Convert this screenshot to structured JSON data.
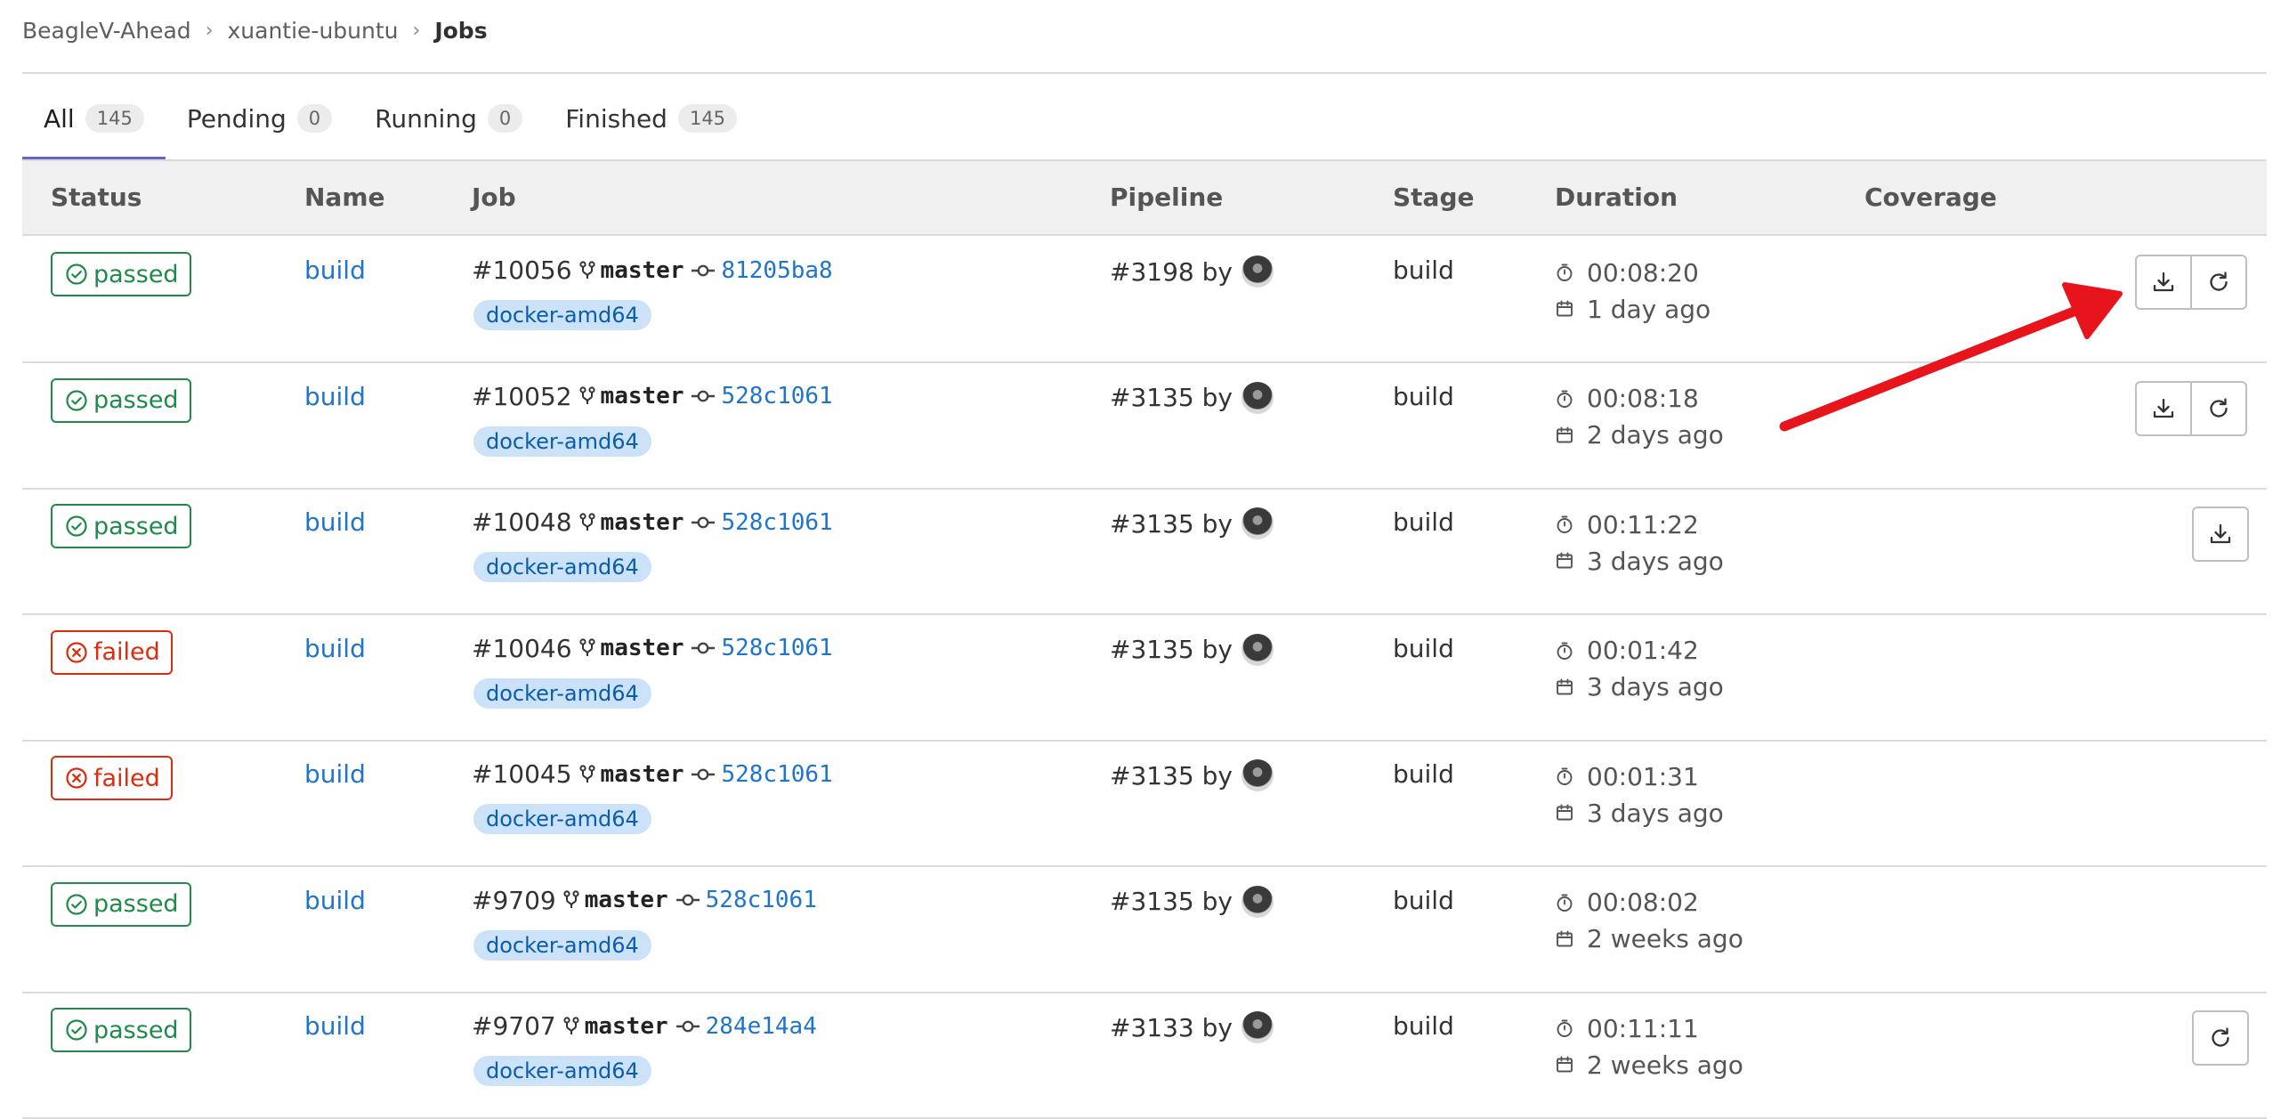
{
  "breadcrumb": {
    "items": [
      "BeagleV-Ahead",
      "xuantie-ubuntu",
      "Jobs"
    ]
  },
  "tabs": [
    {
      "label": "All",
      "count": "145",
      "active": true
    },
    {
      "label": "Pending",
      "count": "0",
      "active": false
    },
    {
      "label": "Running",
      "count": "0",
      "active": false
    },
    {
      "label": "Finished",
      "count": "145",
      "active": false
    }
  ],
  "table": {
    "headers": [
      "Status",
      "Name",
      "Job",
      "Pipeline",
      "Stage",
      "Duration",
      "Coverage"
    ],
    "rows": [
      {
        "status": "passed",
        "name": "build",
        "job_id": "#10056",
        "branch": "master",
        "commit": "81205ba8",
        "tag": "docker-amd64",
        "pipeline": "#3198",
        "by": "by",
        "stage": "build",
        "duration": "00:08:20",
        "finished": "1 day ago",
        "actions": [
          "download",
          "retry"
        ]
      },
      {
        "status": "passed",
        "name": "build",
        "job_id": "#10052",
        "branch": "master",
        "commit": "528c1061",
        "tag": "docker-amd64",
        "pipeline": "#3135",
        "by": "by",
        "stage": "build",
        "duration": "00:08:18",
        "finished": "2 days ago",
        "actions": [
          "download",
          "retry"
        ]
      },
      {
        "status": "passed",
        "name": "build",
        "job_id": "#10048",
        "branch": "master",
        "commit": "528c1061",
        "tag": "docker-amd64",
        "pipeline": "#3135",
        "by": "by",
        "stage": "build",
        "duration": "00:11:22",
        "finished": "3 days ago",
        "actions": [
          "download"
        ]
      },
      {
        "status": "failed",
        "name": "build",
        "job_id": "#10046",
        "branch": "master",
        "commit": "528c1061",
        "tag": "docker-amd64",
        "pipeline": "#3135",
        "by": "by",
        "stage": "build",
        "duration": "00:01:42",
        "finished": "3 days ago",
        "actions": []
      },
      {
        "status": "failed",
        "name": "build",
        "job_id": "#10045",
        "branch": "master",
        "commit": "528c1061",
        "tag": "docker-amd64",
        "pipeline": "#3135",
        "by": "by",
        "stage": "build",
        "duration": "00:01:31",
        "finished": "3 days ago",
        "actions": []
      },
      {
        "status": "passed",
        "name": "build",
        "job_id": "#9709",
        "branch": "master",
        "commit": "528c1061",
        "tag": "docker-amd64",
        "pipeline": "#3135",
        "by": "by",
        "stage": "build",
        "duration": "00:08:02",
        "finished": "2 weeks ago",
        "actions": []
      },
      {
        "status": "passed",
        "name": "build",
        "job_id": "#9707",
        "branch": "master",
        "commit": "284e14a4",
        "tag": "docker-amd64",
        "pipeline": "#3133",
        "by": "by",
        "stage": "build",
        "duration": "00:11:11",
        "finished": "2 weeks ago",
        "actions": [
          "retry"
        ]
      }
    ]
  },
  "colors": {
    "passed": "#1f8a4a",
    "failed": "#dd2b0e",
    "link": "#1f75cb",
    "tab_active_underline": "#6666c4",
    "annotation_arrow": "#e8141c"
  },
  "icons": {
    "passed": "check-circle-icon",
    "failed": "x-circle-icon",
    "branch": "git-branch-icon",
    "commit": "git-commit-icon",
    "duration": "timer-icon",
    "finished": "calendar-icon",
    "download": "download-icon",
    "retry": "retry-icon"
  }
}
